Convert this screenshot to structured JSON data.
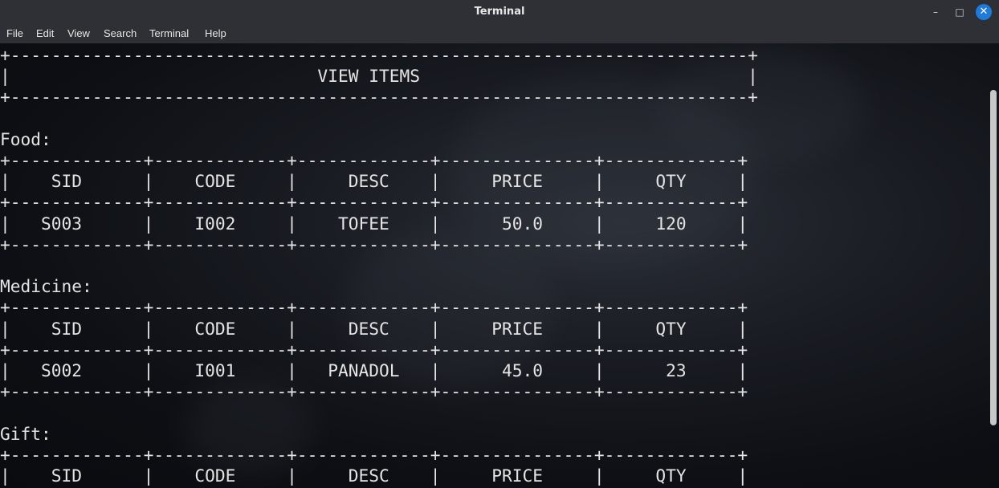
{
  "window": {
    "title": "Terminal",
    "controls": {
      "minimize": "–",
      "maximize": "□",
      "close": "✕"
    }
  },
  "menubar": {
    "items": [
      "File",
      "Edit",
      "View",
      "Search",
      "Terminal",
      "Help"
    ]
  },
  "terminal": {
    "lines": [
      "+------------------------------------------------------------------------+",
      "|                              VIEW ITEMS                                |",
      "+------------------------------------------------------------------------+",
      "",
      "Food:",
      "+-------------+-------------+-------------+---------------+-------------+",
      "|    SID      |    CODE     |     DESC    |     PRICE     |     QTY     |",
      "+-------------+-------------+-------------+---------------+-------------+",
      "|   S003      |    I002     |    TOFEE    |      50.0     |     120     |",
      "+-------------+-------------+-------------+---------------+-------------+",
      "",
      "Medicine:",
      "+-------------+-------------+-------------+---------------+-------------+",
      "|    SID      |    CODE     |     DESC    |     PRICE     |     QTY     |",
      "+-------------+-------------+-------------+---------------+-------------+",
      "|   S002      |    I001     |   PANADOL   |      45.0     |      23     |",
      "+-------------+-------------+-------------+---------------+-------------+",
      "",
      "Gift:",
      "+-------------+-------------+-------------+---------------+-------------+",
      "|    SID      |    CODE     |     DESC    |     PRICE     |     QTY     |"
    ]
  }
}
